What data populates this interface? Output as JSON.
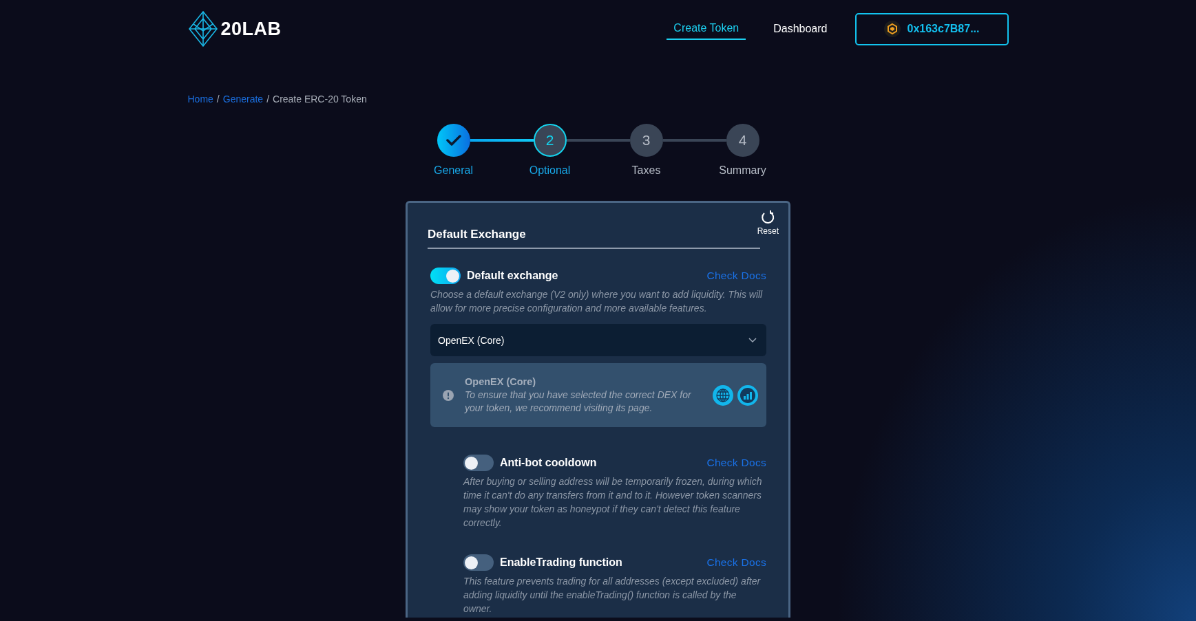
{
  "header": {
    "logo": "20LAB",
    "nav": [
      {
        "label": "Create Token",
        "selected": true
      },
      {
        "label": "Dashboard",
        "selected": false
      }
    ],
    "wallet": "0x163c7B87..."
  },
  "breadcrumb": {
    "separator": "/",
    "items": [
      {
        "label": "Home",
        "kind": "link"
      },
      {
        "label": "Generate",
        "kind": "link"
      },
      {
        "label": "Create ERC-20 Token",
        "kind": "current"
      }
    ]
  },
  "steps": [
    {
      "label": "General",
      "completed": true,
      "selected": false
    },
    {
      "label": "Optional",
      "number": "2",
      "completed": false,
      "selected": true
    },
    {
      "label": "Taxes",
      "number": "3",
      "completed": false,
      "selected": false
    },
    {
      "label": "Summary",
      "number": "4",
      "completed": false,
      "selected": false
    }
  ],
  "card": {
    "title": "Default Exchange",
    "reset": "Reset",
    "options": [
      {
        "label": "Default exchange",
        "on": true,
        "docs": "Check Docs",
        "description": "Choose a default exchange (V2 only) where you want to add liquidity. This will allow for more precise configuration and more available features.",
        "select": {
          "value": "OpenEX (Core)"
        },
        "info": {
          "title": "OpenEX (Core)",
          "text": "To ensure that you have selected the correct DEX for your token, we recommend visiting its page."
        },
        "children": [
          {
            "label": "Anti-bot cooldown",
            "on": false,
            "docs": "Check Docs",
            "description": "After buying or selling address will be temporarily frozen, during which time it can't do any transfers from it and to it. However token scanners may show your token as honeypot if they can't detect this feature correctly."
          },
          {
            "label": "EnableTrading function",
            "on": false,
            "docs": "Check Docs",
            "description": "This feature prevents trading for all addresses (except excluded) after adding liquidity until the enableTrading() function is called by the owner."
          }
        ]
      }
    ]
  }
}
